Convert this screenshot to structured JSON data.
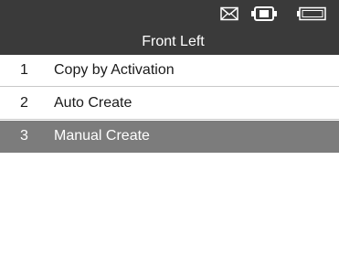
{
  "header": {
    "title": "Front Left",
    "icons": [
      "mail-icon",
      "battery-connector-icon",
      "battery-icon"
    ]
  },
  "menu": {
    "items": [
      {
        "number": "1",
        "label": "Copy by Activation",
        "selected": false
      },
      {
        "number": "2",
        "label": "Auto Create",
        "selected": false
      },
      {
        "number": "3",
        "label": "Manual Create",
        "selected": true
      }
    ]
  },
  "colors": {
    "header_bg": "#3a3a3a",
    "selected_bg": "#7c7c7c",
    "divider": "#c8c8c8"
  }
}
